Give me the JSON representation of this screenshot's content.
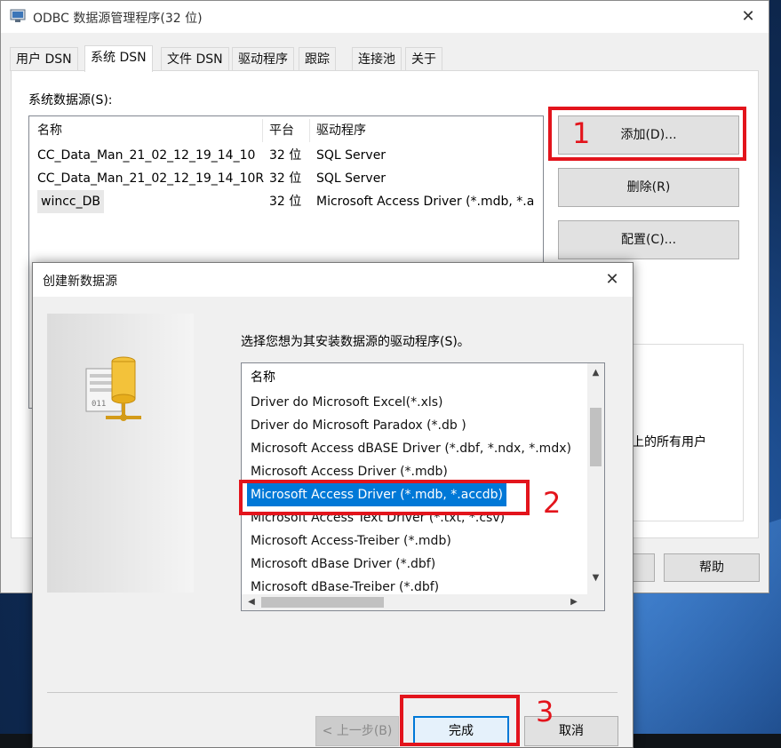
{
  "odbc_window": {
    "title": "ODBC 数据源管理程序(32 位)",
    "close_glyph": "✕",
    "tabs": [
      {
        "label": "用户 DSN"
      },
      {
        "label": "系统 DSN"
      },
      {
        "label": "文件 DSN"
      },
      {
        "label": "驱动程序"
      },
      {
        "label": "跟踪"
      },
      {
        "label": "连接池"
      },
      {
        "label": "关于"
      }
    ],
    "active_tab": "系统 DSN",
    "system_dsn_label": "系统数据源(S):",
    "list_columns": [
      "名称",
      "平台",
      "驱动程序"
    ],
    "rows": [
      {
        "name": "CC_Data_Man_21_02_12_19_14_10",
        "platform": "32 位",
        "driver": "SQL Server"
      },
      {
        "name": "CC_Data_Man_21_02_12_19_14_10R",
        "platform": "32 位",
        "driver": "SQL Server"
      },
      {
        "name": "wincc_DB",
        "platform": "32 位",
        "driver": "Microsoft Access Driver (*.mdb, *.a"
      }
    ],
    "buttons": {
      "add": "添加(D)...",
      "remove": "删除(R)",
      "configure": "配置(C)...",
      "help": "帮助"
    },
    "info_text_fragment": "上的所有用户"
  },
  "create_dialog": {
    "title": "创建新数据源",
    "close_glyph": "✕",
    "prompt": "选择您想为其安装数据源的驱动程序(S)。",
    "list_header": "名称",
    "drivers": [
      "Driver do Microsoft Excel(*.xls)",
      "Driver do Microsoft Paradox (*.db )",
      "Microsoft Access dBASE Driver (*.dbf, *.ndx, *.mdx)",
      "Microsoft Access Driver (*.mdb)",
      "Microsoft Access Driver (*.mdb, *.accdb)",
      "Microsoft Access Text Driver (*.txt, *.csv)",
      "Microsoft Access-Treiber (*.mdb)",
      "Microsoft dBase Driver (*.dbf)",
      "Microsoft dBase-Treiber (*.dbf)"
    ],
    "selected_driver": "Microsoft Access Driver (*.mdb, *.accdb)",
    "scroll_glyphs": {
      "up": "▲",
      "down": "▼",
      "left": "◀",
      "right": "▶"
    },
    "buttons": {
      "back": "< 上一步(B)",
      "finish": "完成",
      "cancel": "取消"
    }
  },
  "annotations": {
    "labels": [
      "1",
      "2",
      "3"
    ],
    "color": "#e3141c"
  },
  "colors": {
    "selection": "#0078d7",
    "annotation": "#e3141c"
  }
}
